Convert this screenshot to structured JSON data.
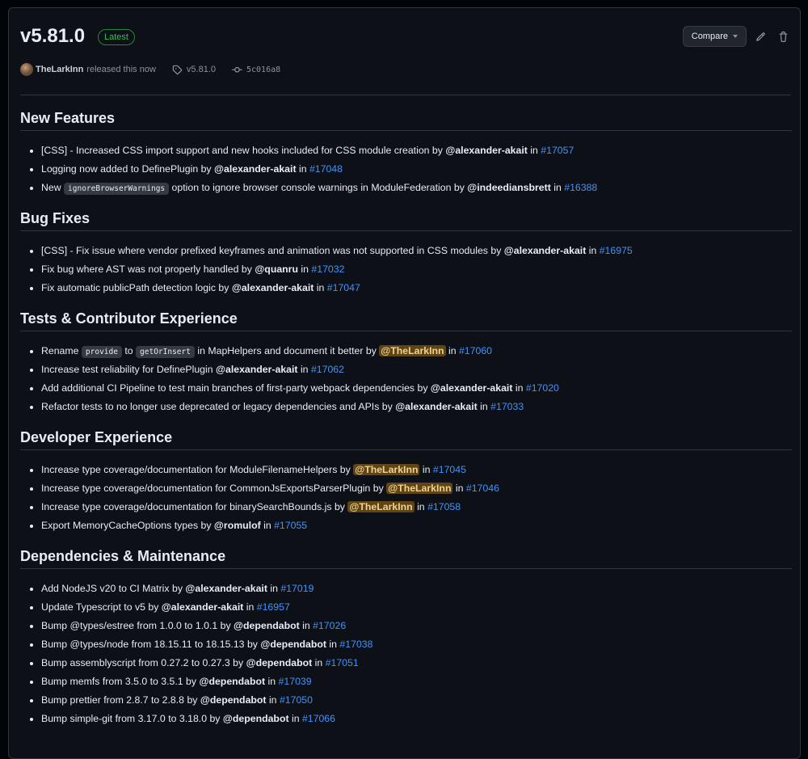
{
  "release": {
    "title": "v5.81.0",
    "badge": "Latest",
    "author": "TheLarkInn",
    "released_text": "released this now",
    "tag": "v5.81.0",
    "commit": "5c016a8",
    "compare_label": "Compare"
  },
  "sections": [
    {
      "title": "New Features",
      "items": [
        {
          "parts": [
            {
              "t": "text",
              "v": "[CSS] - Increased CSS import support and new hooks included for CSS module creation by "
            },
            {
              "t": "user",
              "v": "@alexander-akait"
            },
            {
              "t": "text",
              "v": " in "
            },
            {
              "t": "pr",
              "v": "#17057"
            }
          ]
        },
        {
          "parts": [
            {
              "t": "text",
              "v": "Logging now added to DefinePlugin by "
            },
            {
              "t": "user",
              "v": "@alexander-akait"
            },
            {
              "t": "text",
              "v": " in "
            },
            {
              "t": "pr",
              "v": "#17048"
            }
          ]
        },
        {
          "parts": [
            {
              "t": "text",
              "v": "New "
            },
            {
              "t": "code",
              "v": "ignoreBrowserWarnings"
            },
            {
              "t": "text",
              "v": " option to ignore browser console warnings in ModuleFederation by "
            },
            {
              "t": "user",
              "v": "@indeediansbrett"
            },
            {
              "t": "text",
              "v": " in "
            },
            {
              "t": "pr",
              "v": "#16388"
            }
          ]
        }
      ]
    },
    {
      "title": "Bug Fixes",
      "items": [
        {
          "parts": [
            {
              "t": "text",
              "v": "[CSS] - Fix issue where vendor prefixed keyframes and animation was not supported in CSS modules by "
            },
            {
              "t": "user",
              "v": "@alexander-akait"
            },
            {
              "t": "text",
              "v": " in "
            },
            {
              "t": "pr",
              "v": "#16975"
            }
          ]
        },
        {
          "parts": [
            {
              "t": "text",
              "v": "Fix bug where AST was not properly handled by "
            },
            {
              "t": "user",
              "v": "@quanru"
            },
            {
              "t": "text",
              "v": " in "
            },
            {
              "t": "pr",
              "v": "#17032"
            }
          ]
        },
        {
          "parts": [
            {
              "t": "text",
              "v": "Fix automatic publicPath detection logic by "
            },
            {
              "t": "user",
              "v": "@alexander-akait"
            },
            {
              "t": "text",
              "v": " in "
            },
            {
              "t": "pr",
              "v": "#17047"
            }
          ]
        }
      ]
    },
    {
      "title": "Tests & Contributor Experience",
      "items": [
        {
          "parts": [
            {
              "t": "text",
              "v": "Rename "
            },
            {
              "t": "code",
              "v": "provide"
            },
            {
              "t": "text",
              "v": " to "
            },
            {
              "t": "code",
              "v": "getOrInsert"
            },
            {
              "t": "text",
              "v": " in MapHelpers and document it better by "
            },
            {
              "t": "userhl",
              "v": "@TheLarkInn"
            },
            {
              "t": "text",
              "v": " in "
            },
            {
              "t": "pr",
              "v": "#17060"
            }
          ]
        },
        {
          "parts": [
            {
              "t": "text",
              "v": "Increase test reliability for DefinePlugin "
            },
            {
              "t": "user",
              "v": "@alexander-akait"
            },
            {
              "t": "text",
              "v": " in "
            },
            {
              "t": "pr",
              "v": "#17062"
            }
          ]
        },
        {
          "parts": [
            {
              "t": "text",
              "v": "Add additional CI Pipeline to test main branches of first-party webpack dependencies by "
            },
            {
              "t": "user",
              "v": "@alexander-akait"
            },
            {
              "t": "text",
              "v": " in "
            },
            {
              "t": "pr",
              "v": "#17020"
            }
          ]
        },
        {
          "parts": [
            {
              "t": "text",
              "v": "Refactor tests to no longer use deprecated or legacy dependencies and APIs by "
            },
            {
              "t": "user",
              "v": "@alexander-akait"
            },
            {
              "t": "text",
              "v": " in "
            },
            {
              "t": "pr",
              "v": "#17033"
            }
          ]
        }
      ]
    },
    {
      "title": "Developer Experience",
      "items": [
        {
          "parts": [
            {
              "t": "text",
              "v": "Increase type coverage/documentation for ModuleFilenameHelpers by "
            },
            {
              "t": "userhl",
              "v": "@TheLarkInn"
            },
            {
              "t": "text",
              "v": " in "
            },
            {
              "t": "pr",
              "v": "#17045"
            }
          ]
        },
        {
          "parts": [
            {
              "t": "text",
              "v": "Increase type coverage/documentation for CommonJsExportsParserPlugin by "
            },
            {
              "t": "userhl",
              "v": "@TheLarkInn"
            },
            {
              "t": "text",
              "v": " in "
            },
            {
              "t": "pr",
              "v": "#17046"
            }
          ]
        },
        {
          "parts": [
            {
              "t": "text",
              "v": "Increase type coverage/documentation for binarySearchBounds.js by "
            },
            {
              "t": "userhl",
              "v": "@TheLarkInn"
            },
            {
              "t": "text",
              "v": " in "
            },
            {
              "t": "pr",
              "v": "#17058"
            }
          ]
        },
        {
          "parts": [
            {
              "t": "text",
              "v": "Export MemoryCacheOptions types by "
            },
            {
              "t": "user",
              "v": "@romulof"
            },
            {
              "t": "text",
              "v": " in "
            },
            {
              "t": "pr",
              "v": "#17055"
            }
          ]
        }
      ]
    },
    {
      "title": "Dependencies & Maintenance",
      "items": [
        {
          "parts": [
            {
              "t": "text",
              "v": "Add NodeJS v20 to CI Matrix by "
            },
            {
              "t": "user",
              "v": "@alexander-akait"
            },
            {
              "t": "text",
              "v": " in "
            },
            {
              "t": "pr",
              "v": "#17019"
            }
          ]
        },
        {
          "parts": [
            {
              "t": "text",
              "v": "Update Typescript to v5 by "
            },
            {
              "t": "user",
              "v": "@alexander-akait"
            },
            {
              "t": "text",
              "v": " in "
            },
            {
              "t": "pr",
              "v": "#16957"
            }
          ]
        },
        {
          "parts": [
            {
              "t": "text",
              "v": "Bump @types/estree from 1.0.0 to 1.0.1 by "
            },
            {
              "t": "user",
              "v": "@dependabot"
            },
            {
              "t": "text",
              "v": " in "
            },
            {
              "t": "pr",
              "v": "#17026"
            }
          ]
        },
        {
          "parts": [
            {
              "t": "text",
              "v": "Bump @types/node from 18.15.11 to 18.15.13 by "
            },
            {
              "t": "user",
              "v": "@dependabot"
            },
            {
              "t": "text",
              "v": " in "
            },
            {
              "t": "pr",
              "v": "#17038"
            }
          ]
        },
        {
          "parts": [
            {
              "t": "text",
              "v": "Bump assemblyscript from 0.27.2 to 0.27.3 by "
            },
            {
              "t": "user",
              "v": "@dependabot"
            },
            {
              "t": "text",
              "v": " in "
            },
            {
              "t": "pr",
              "v": "#17051"
            }
          ]
        },
        {
          "parts": [
            {
              "t": "text",
              "v": "Bump memfs from 3.5.0 to 3.5.1 by "
            },
            {
              "t": "user",
              "v": "@dependabot"
            },
            {
              "t": "text",
              "v": " in "
            },
            {
              "t": "pr",
              "v": "#17039"
            }
          ]
        },
        {
          "parts": [
            {
              "t": "text",
              "v": "Bump prettier from 2.8.7 to 2.8.8 by "
            },
            {
              "t": "user",
              "v": "@dependabot"
            },
            {
              "t": "text",
              "v": " in "
            },
            {
              "t": "pr",
              "v": "#17050"
            }
          ]
        },
        {
          "parts": [
            {
              "t": "text",
              "v": "Bump simple-git from 3.17.0 to 3.18.0 by "
            },
            {
              "t": "user",
              "v": "@dependabot"
            },
            {
              "t": "text",
              "v": " in "
            },
            {
              "t": "pr",
              "v": "#17066"
            }
          ]
        }
      ]
    }
  ]
}
